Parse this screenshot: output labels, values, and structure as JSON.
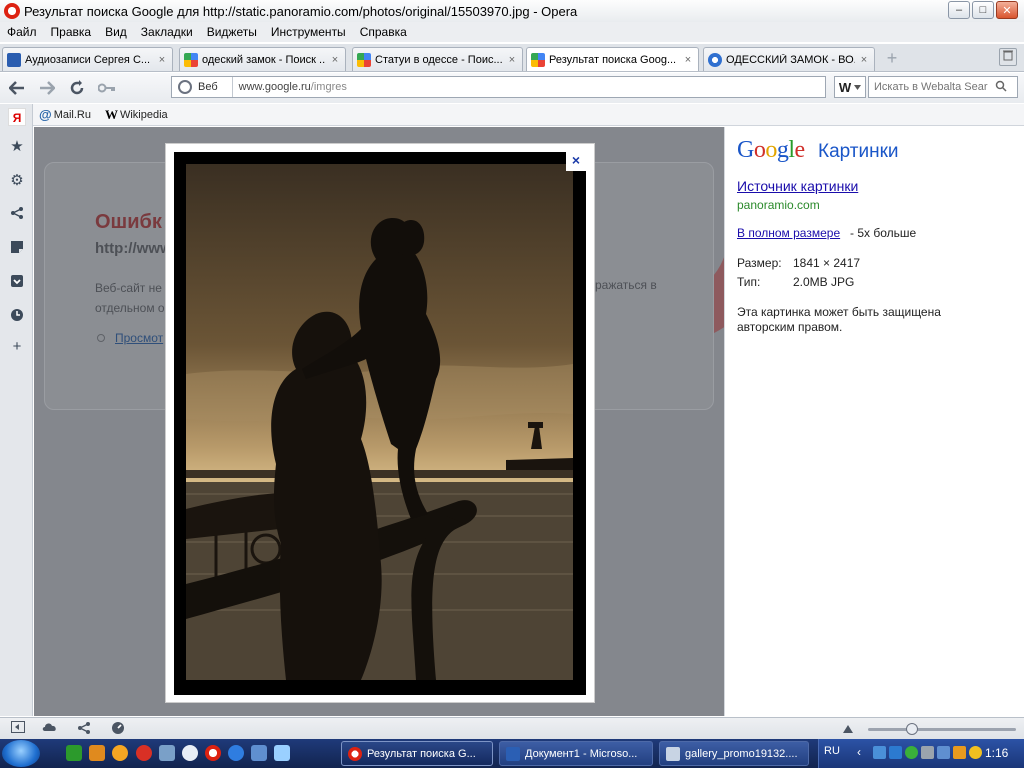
{
  "window": {
    "title": "Результат поиска Google для http://static.panoramio.com/photos/original/15503970.jpg - Opera",
    "buttons": {
      "minimize": "–",
      "maximize": "□",
      "close": "✕"
    }
  },
  "menu": {
    "items": [
      "Файл",
      "Правка",
      "Вид",
      "Закладки",
      "Виджеты",
      "Инструменты",
      "Справка"
    ]
  },
  "tabs": [
    {
      "label": "Аудиозаписи Сергея С...",
      "icon": "audio-icon"
    },
    {
      "label": "одеский замок - Поиск ...",
      "icon": "google-icon"
    },
    {
      "label": "Статуи в одессе - Поис...",
      "icon": "google-icon"
    },
    {
      "label": "Результат поиска Goog...",
      "icon": "google-icon",
      "active": true
    },
    {
      "label": "ОДЕССКИЙ ЗАМОК - ВО...",
      "icon": "site-icon"
    }
  ],
  "tab_close_glyph": "×",
  "new_tab_glyph": "+",
  "nav": {
    "address_label": "Веб",
    "url_domain": "www.google.ru",
    "url_path": "/imgres",
    "search_engine": "W",
    "search_placeholder": "Искать в Webalta Sear"
  },
  "bookmarks": [
    {
      "label": "Mail.Ru",
      "icon": "mailru-icon",
      "glyph": "@"
    },
    {
      "label": "Wikipedia",
      "icon": "wikipedia-icon",
      "glyph": "W"
    }
  ],
  "sidepanel": {
    "yandex_glyph": "Я"
  },
  "page_behind": {
    "error_title": "Ошибк",
    "error_url": "http://www",
    "text_line1": "Веб-сайт не",
    "text_line2": "отдельном о",
    "text_right": "ражаться в",
    "link": "Просмот"
  },
  "lightbox": {
    "close_glyph": "×",
    "photo_subject": "silhouette statue of mother holding child on Odessa embankment, sepia"
  },
  "info_panel": {
    "logo_google": "Google",
    "logo_sub": "Картинки",
    "source_link": "Источник картинки",
    "source_domain": "panoramio.com",
    "full_size_link": "В полном размере",
    "full_size_note": " - 5x больше",
    "size_label": "Размер:",
    "size_value": "1841 × 2417",
    "type_label": "Тип:",
    "type_value": "2.0MB JPG",
    "copyright_notice": "Эта картинка может быть защищена авторским правом."
  },
  "statusbar": {
    "zoom_level": 0.3
  },
  "taskbar": {
    "tasks": [
      {
        "label": "Результат поиска G...",
        "icon": "opera-icon",
        "active": true
      },
      {
        "label": "Документ1 - Microso...",
        "icon": "word-icon"
      },
      {
        "label": "gallery_promo19132....",
        "icon": "image-icon"
      }
    ],
    "language": "RU",
    "time": "1:16"
  },
  "colors": {
    "accent_link": "#1a0dab",
    "domain_green": "#2b8a2b",
    "opera_red": "#d21"
  }
}
